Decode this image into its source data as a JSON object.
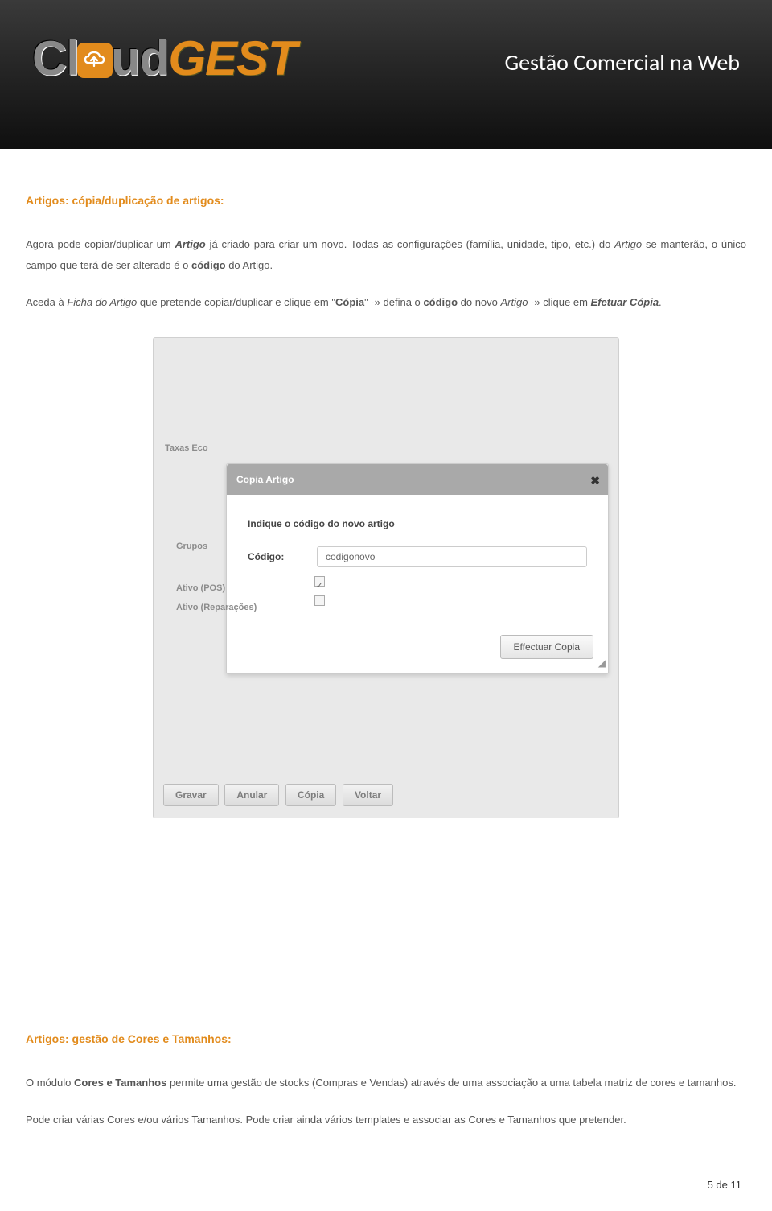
{
  "header": {
    "logo_cl": "Cl",
    "logo_ud": "ud",
    "logo_gest": "GEST",
    "tagline": "Gestão Comercial na Web"
  },
  "section1": {
    "title": "Artigos: cópia/duplicação de artigos:",
    "p1_a": "Agora pode ",
    "p1_b": "copiar/duplicar",
    "p1_c": " um ",
    "p1_d": "Artigo",
    "p1_e": " já criado para criar um novo. Todas as configurações (família, unidade, tipo, etc.) do ",
    "p1_f": "Artigo",
    "p1_g": " se manterão, o único campo que terá de ser alterado é o ",
    "p1_h": "código",
    "p1_i": " do Artigo.",
    "p2_a": "Aceda à ",
    "p2_b": "Ficha do Artigo",
    "p2_c": " que pretende copiar/duplicar e clique em \"",
    "p2_d": "Cópia",
    "p2_e": "\" -» defina o ",
    "p2_f": "código",
    "p2_g": " do novo ",
    "p2_h": "Artigo",
    "p2_i": " -» clique em ",
    "p2_j": "Efetuar Cópia",
    "p2_k": "."
  },
  "modal": {
    "title": "Copia Artigo",
    "prompt": "Indique o código do novo artigo",
    "field_label": "Código:",
    "field_value": "codigonovo",
    "button": "Effectuar Copia"
  },
  "sidebar": {
    "taxas": "Taxas Eco",
    "grupos": "Grupos",
    "ativo_pos": "Ativo (POS)",
    "ativo_rep": "Ativo (Reparações)"
  },
  "btnbar": {
    "gravar": "Gravar",
    "anular": "Anular",
    "copia": "Cópia",
    "voltar": "Voltar"
  },
  "section2": {
    "title": "Artigos: gestão de Cores e Tamanhos:",
    "p1_a": "O módulo ",
    "p1_b": "Cores e Tamanhos",
    "p1_c": " permite uma gestão de stocks (Compras e Vendas) através de uma associação a uma tabela matriz de cores e tamanhos.",
    "p2": "Pode criar várias Cores e/ou vários Tamanhos. Pode criar ainda vários templates e associar as Cores e Tamanhos que pretender."
  },
  "footer": {
    "page": "5 de 11"
  }
}
